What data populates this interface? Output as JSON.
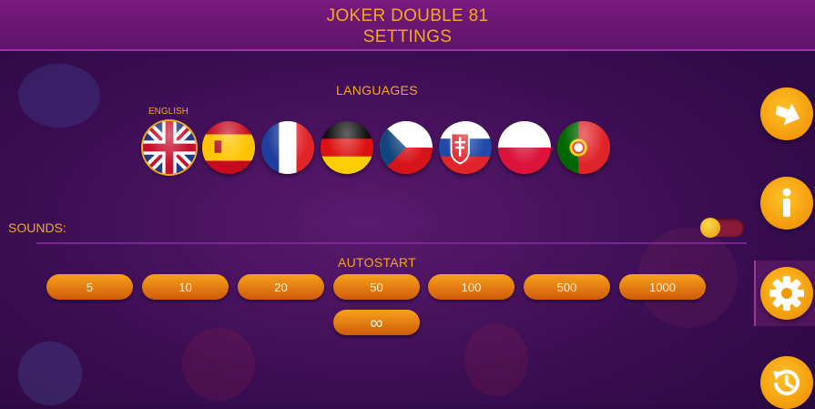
{
  "header": {
    "title": "JOKER DOUBLE 81",
    "subtitle": "SETTINGS"
  },
  "languages": {
    "label": "LANGUAGES",
    "selected_name": "ENGLISH",
    "flags": [
      {
        "code": "en",
        "icon": "uk-flag-icon"
      },
      {
        "code": "es",
        "icon": "spain-flag-icon"
      },
      {
        "code": "fr",
        "icon": "france-flag-icon"
      },
      {
        "code": "de",
        "icon": "germany-flag-icon"
      },
      {
        "code": "cz",
        "icon": "czech-flag-icon"
      },
      {
        "code": "sk",
        "icon": "slovakia-flag-icon"
      },
      {
        "code": "pl",
        "icon": "poland-flag-icon"
      },
      {
        "code": "pt",
        "icon": "portugal-flag-icon"
      }
    ]
  },
  "sounds": {
    "label": "SOUNDS:",
    "enabled": false
  },
  "autostart": {
    "label": "AUTOSTART",
    "options": [
      "5",
      "10",
      "20",
      "50",
      "100",
      "500",
      "1000"
    ],
    "infinite_label": "∞"
  },
  "sidebar": {
    "icons": [
      "arrow-right-icon",
      "info-icon",
      "gear-icon",
      "history-icon"
    ],
    "active": "gear-icon"
  },
  "colors": {
    "accent": "#f6a81c",
    "button": "#e8800f",
    "background": "#3a0d52"
  }
}
